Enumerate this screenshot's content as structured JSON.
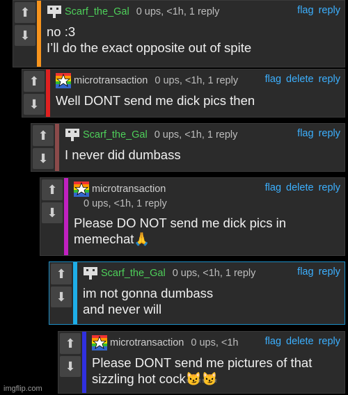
{
  "comments": [
    {
      "user": "Scarf_the_Gal",
      "meta": "0 ups, <1h, 1 reply",
      "actions": [
        "flag",
        "reply"
      ],
      "text": "no :3\nI’ll do the exact opposite out of spite",
      "stripe": "#f7941d"
    },
    {
      "user": "microtransaction",
      "meta": "0 ups, <1h, 1 reply",
      "actions": [
        "flag",
        "delete",
        "reply"
      ],
      "text": "Well DONT send me dick pics then",
      "stripe": "#e02020"
    },
    {
      "user": "Scarf_the_Gal",
      "meta": "0 ups, <1h, 1 reply",
      "actions": [
        "flag",
        "reply"
      ],
      "text": "I never did dumbass",
      "stripe": "#8b4a4a"
    },
    {
      "user": "microtransaction",
      "meta": "0 ups, <1h, 1 reply",
      "actions": [
        "flag",
        "delete",
        "reply"
      ],
      "text": "Please DO NOT send me dick pics in\nmemechat🙏",
      "stripe": "#c020c0"
    },
    {
      "user": "Scarf_the_Gal",
      "meta": "0 ups, <1h, 1 reply",
      "actions": [
        "flag",
        "reply"
      ],
      "text": "im not gonna dumbass\nand never will",
      "stripe": "#1eaee8"
    },
    {
      "user": "microtransaction",
      "meta": "0 ups, <1h",
      "actions": [
        "flag",
        "delete",
        "reply"
      ],
      "text": "Please DONT send me pictures of that\nsizzling hot cock😼😼",
      "stripe": "#3030e0"
    }
  ],
  "vote": {
    "up": "⬆",
    "down": "⬇"
  },
  "watermark": "imgflip.com"
}
